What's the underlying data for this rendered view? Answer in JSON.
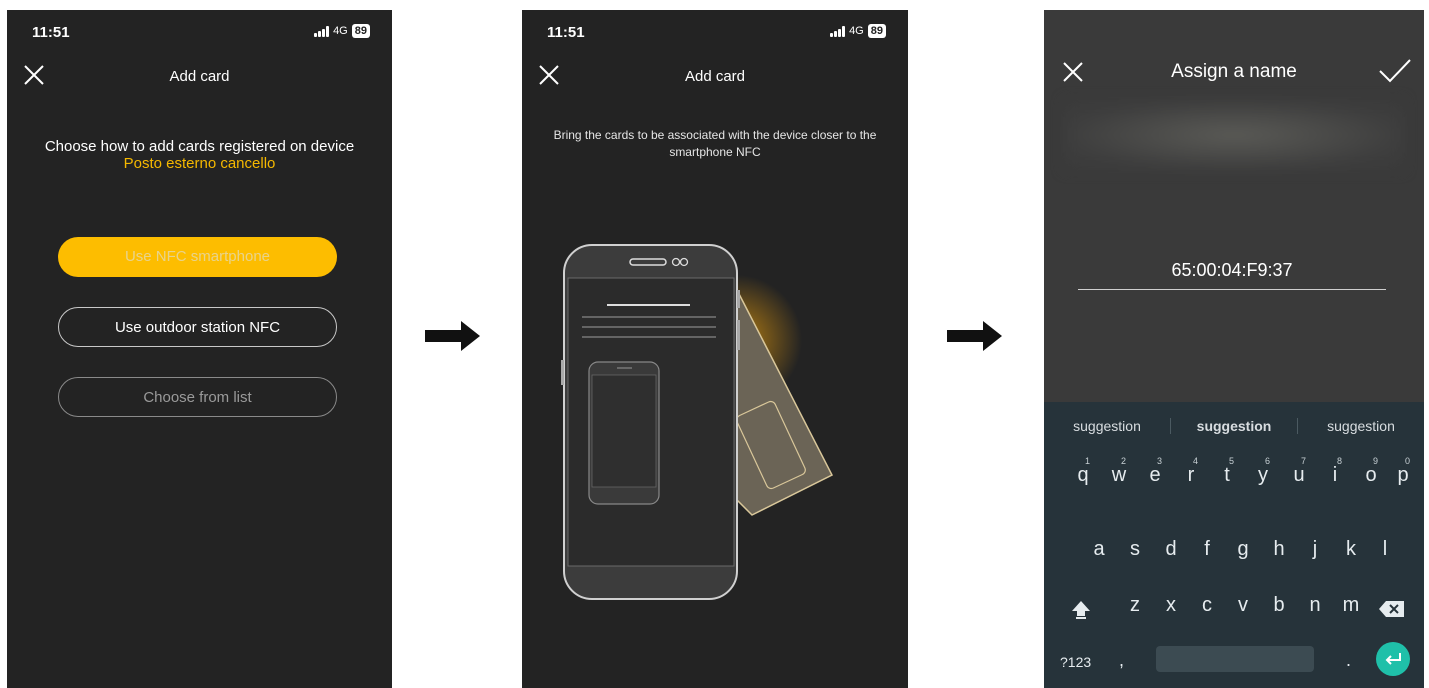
{
  "screen1": {
    "time": "11:51",
    "network": "4G",
    "battery": "89",
    "title": "Add card",
    "instruction": "Choose how to add cards registered on device",
    "device_name": "Posto esterno cancello",
    "options": [
      "Use NFC smartphone",
      "Use outdoor station NFC",
      "Choose from list"
    ]
  },
  "screen2": {
    "time": "11:51",
    "network": "4G",
    "battery": "89",
    "title": "Add card",
    "instruction": "Bring the cards to be associated with the device closer to the smartphone NFC"
  },
  "screen3": {
    "title": "Assign a name",
    "name_value": "65:00:04:F9:37",
    "suggestions": [
      "suggestion",
      "suggestion",
      "suggestion"
    ],
    "keys_row1": [
      "q",
      "w",
      "e",
      "r",
      "t",
      "y",
      "u",
      "i",
      "o",
      "p"
    ],
    "digits_row1": [
      "1",
      "2",
      "3",
      "4",
      "5",
      "6",
      "7",
      "8",
      "9",
      "0"
    ],
    "keys_row2": [
      "a",
      "s",
      "d",
      "f",
      "g",
      "h",
      "j",
      "k",
      "l"
    ],
    "keys_row3": [
      "z",
      "x",
      "c",
      "v",
      "b",
      "n",
      "m"
    ],
    "symbols_key": "?123",
    "comma_key": ",",
    "period_key": "."
  },
  "icons": {
    "close": "close-icon",
    "confirm": "checkmark-icon",
    "arrow": "arrow-right-icon",
    "shift": "shift-icon",
    "backspace": "backspace-icon",
    "enter": "enter-icon"
  },
  "colors": {
    "accent": "#fdbd00",
    "device_name": "#f5b800",
    "enter_key": "#1fc0a9"
  }
}
